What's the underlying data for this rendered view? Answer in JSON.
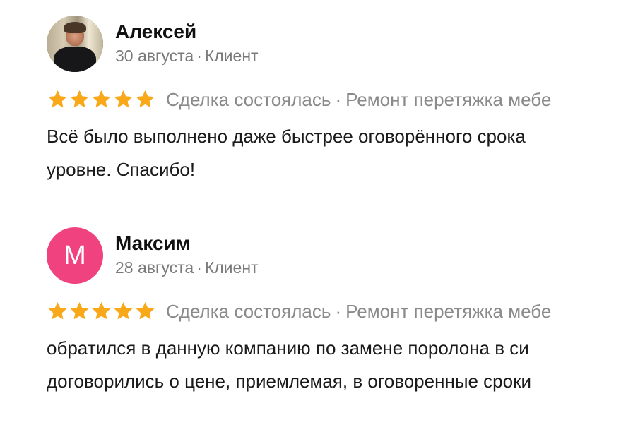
{
  "reviews": [
    {
      "author": "Алексей",
      "date": "30 августа",
      "role": "Клиент",
      "avatar": {
        "type": "photo"
      },
      "rating": 5,
      "deal_status": "Сделка состоялась",
      "service": "Ремонт перетяжка мебе",
      "text_lines": [
        "Всё было выполнено даже быстрее оговорённого срока",
        "уровне. Спасибо!"
      ]
    },
    {
      "author": "Максим",
      "date": "28 августа",
      "role": "Клиент",
      "avatar": {
        "type": "letter",
        "letter": "М",
        "color": "#f0427f"
      },
      "rating": 5,
      "deal_status": "Сделка состоялась",
      "service": "Ремонт перетяжка мебе",
      "text_lines": [
        "обратился в данную компанию по замене поролона в си",
        "договорились о цене, приемлемая, в оговоренные сроки"
      ]
    }
  ],
  "separator": "·",
  "star_color": "#f9a81a",
  "star_icon": "star-icon"
}
